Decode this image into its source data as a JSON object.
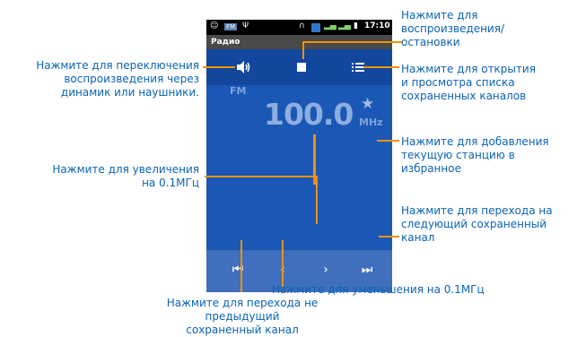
{
  "status_bar": {
    "left_icons": [
      "smiley-icon",
      "fm-icon",
      "usb-icon"
    ],
    "fm_badge": "FM",
    "time": "17:10"
  },
  "app": {
    "title": "Радио"
  },
  "radio": {
    "band": "FM",
    "frequency": "100.0",
    "unit": "MHz",
    "buttons": [
      "speaker-toggle-icon",
      "stop-icon",
      "list-icon",
      "favorite-star-icon"
    ]
  },
  "navbar": {
    "buttons": [
      "skip-previous-icon",
      "chevron-left-icon",
      "chevron-right-icon",
      "skip-next-icon"
    ]
  },
  "callouts": {
    "play_stop": "Нажмите для\nвоспроизведения/\nостановки",
    "speaker": "Нажмите для переключения\nвоспроизведения через\nдинамик или наушники.",
    "list": "Нажмите для открытия\nи просмотра списка\nсохраненных каналов",
    "favorite": "Нажмите для добавления\nтекущую станцию в\nизбранное",
    "increase": "Нажмите для увеличения\nна 0.1МГц",
    "next_saved": "Нажмите для перехода на\nследующий сохраненный\nканал",
    "decrease": "Нажмите для уменьшения на 0.1МГц",
    "prev_saved": "Нажмите для перехода не предыдущий\nсохраненный канал"
  },
  "colors": {
    "accent": "#f39200",
    "callout_text": "#0b63b6",
    "screen_bg": "#1b58b6"
  }
}
